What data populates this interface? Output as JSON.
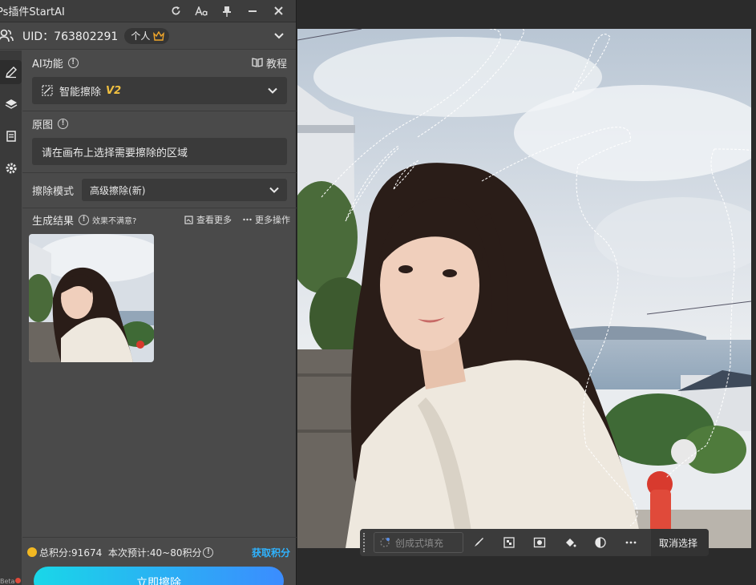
{
  "window": {
    "title": "Ps插件StartAI"
  },
  "user": {
    "uid_text": "UID：763802291",
    "plan_badge": "个人"
  },
  "ai_function": {
    "label": "AI功能",
    "tutorial_label": "教程",
    "selected_function": "智能擦除",
    "version_tag": "V2"
  },
  "source_image": {
    "label": "原图",
    "placeholder": "请在画布上选择需要擦除的区域"
  },
  "erase_mode": {
    "label": "擦除模式",
    "selected": "高级擦除(新)"
  },
  "results": {
    "label": "生成结果",
    "dissatisfied": "效果不满意?",
    "view_more": "查看更多",
    "more_actions": "更多操作"
  },
  "footer": {
    "points_text": "总积分:91674  本次预计:40~80积分",
    "get_points": "获取积分",
    "cta_label": "立即擦除"
  },
  "sidebar": {
    "bottom_text": "Beta"
  },
  "context_toolbar": {
    "generative_fill": "创成式填充",
    "cancel_selection": "取消选择"
  },
  "colors": {
    "panel_bg": "#4a4a4a",
    "accent_link": "#2fb3ff",
    "cta_gradient_start": "#19d7e8",
    "cta_gradient_end": "#3b8cff",
    "version_tag": "#f0c040",
    "coin": "#f2b822"
  },
  "icons": {
    "titlebar": [
      "refresh-icon",
      "font-size-icon",
      "pin-icon",
      "minimize-icon",
      "close-icon"
    ],
    "sidebar": [
      "brush-icon",
      "layers-icon",
      "document-icon",
      "settings-icon"
    ],
    "toolbar": [
      "brush-icon",
      "mosaic-icon",
      "mask-icon",
      "paint-bucket-icon",
      "contrast-icon",
      "more-icon"
    ]
  }
}
